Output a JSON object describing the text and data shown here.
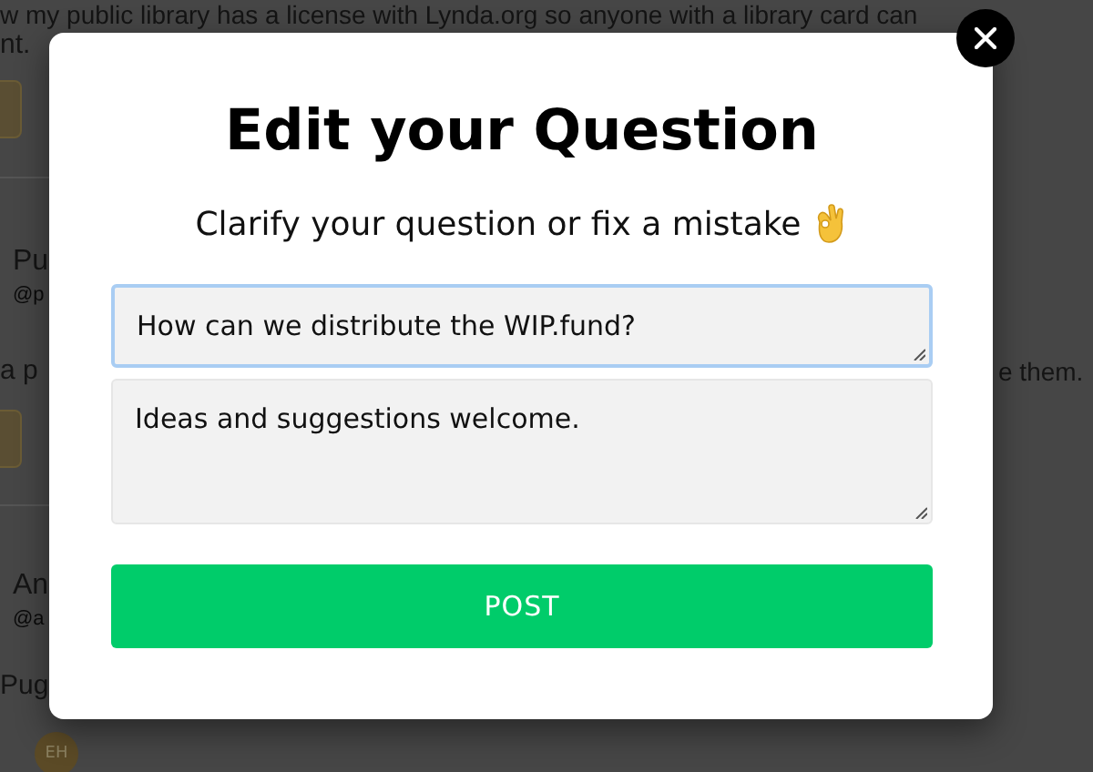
{
  "background": {
    "post_text": "w my public library has a license with Lynda.org so anyone with a library card can",
    "post_text_end": "nt.",
    "items": [
      {
        "kind": "name",
        "text": "Pu"
      },
      {
        "kind": "handle",
        "text": "@p"
      },
      {
        "kind": "body",
        "text": "a p"
      },
      {
        "kind": "name",
        "text": "An"
      },
      {
        "kind": "handle",
        "text": "@a"
      },
      {
        "kind": "body",
        "text": "Pug"
      }
    ],
    "side_text": "e them.",
    "avatar_initials": "EH"
  },
  "dialog": {
    "title": "Edit your Question",
    "subtitle": "Clarify your question or fix a mistake",
    "fields": [
      {
        "kind": "line",
        "value": "How can we distribute the WIP.fund?",
        "focused": true
      },
      {
        "kind": "area",
        "value": "Ideas and suggestions welcome.",
        "focused": false
      }
    ],
    "submit": "POST"
  }
}
